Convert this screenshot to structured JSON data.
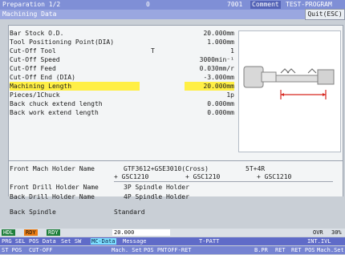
{
  "top": {
    "left": "Preparation  1/2",
    "mid": "0",
    "id": "7001",
    "comment_label": "Comment",
    "program_name": "TEST-PROGRAM"
  },
  "title": {
    "text": "Machining Data",
    "quit": "Quit(ESC)"
  },
  "fields": [
    {
      "label": "Bar Stock O.D.",
      "value": "20.000mm"
    },
    {
      "label": "Tool Positioning Point(DIA)",
      "value": "1.000mm"
    },
    {
      "label": "Cut-Off Tool",
      "value": "1",
      "prefix": "T"
    },
    {
      "label": "Cut-Off Speed",
      "value": "3000min⁻¹"
    },
    {
      "label": "Cut-Off Feed",
      "value": "0.030mm/r"
    },
    {
      "label": "Cut-Off End (DIA)",
      "value": "-3.000mm"
    },
    {
      "label": "Machining Length",
      "value": "20.000mm"
    },
    {
      "label": "Pieces/1Chuck",
      "value": "1p"
    },
    {
      "label": "Back chuck extend length",
      "value": "0.000mm"
    },
    {
      "label": "Back work extend length",
      "value": "0.000mm"
    }
  ],
  "holders": {
    "front_mach_label": "Front Mach Holder Name",
    "front_mach_value": "GTF3612+GSE3010(Cross)",
    "front_mach_code": "5T+4R",
    "front_mach_sub": [
      "+ GSC1210",
      "+ GSC1210",
      "+ GSC1210"
    ],
    "front_drill_label": "Front Drill Holder Name",
    "front_drill_value": "3P Spindle Holder",
    "back_drill_label": "Back Drill Holder Name",
    "back_drill_value": "4P Spindle Holder",
    "back_spindle_label": "Back Spindle",
    "back_spindle_value": "Standard"
  },
  "status": {
    "hdl": "HDL",
    "rdy1": "RDY",
    "rdy2": "RDY",
    "box": "20.000",
    "ovr": "OVR",
    "ovr_value": "30%"
  },
  "fkeys_top": [
    "PRG SEL",
    "POS Data",
    "Set SW",
    "MC-Data",
    "Message",
    "T-PATT",
    "INT.IVL"
  ],
  "fkeys_bottom": [
    "ST POS",
    "CUT-OFF",
    "Mach. Set",
    "POS PNT",
    "OFF-RET",
    "B.PR",
    "RET",
    "RET POS",
    "Mach.Set"
  ]
}
